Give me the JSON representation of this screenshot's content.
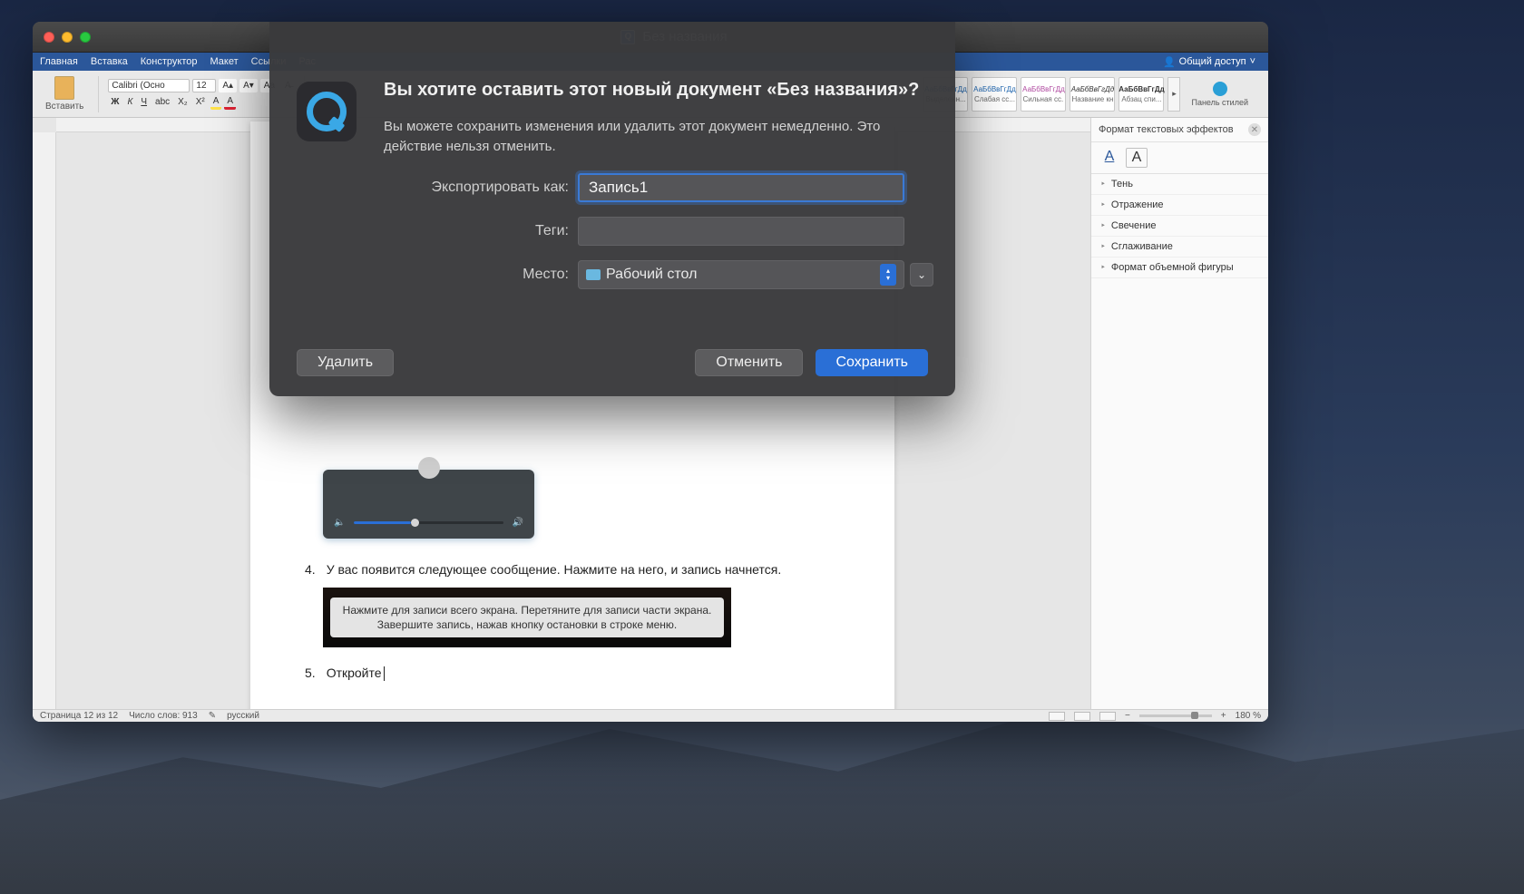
{
  "window": {
    "title": "Без названия"
  },
  "word": {
    "tabs": [
      "Главная",
      "Вставка",
      "Конструктор",
      "Макет",
      "Ссылки",
      "Рас"
    ],
    "share": "Общий доступ",
    "paste_label": "Вставить",
    "font_name": "Calibri (Осно",
    "font_size": "12",
    "styles": [
      {
        "preview": "АаБбВвГгДд",
        "label": "Выделенн..."
      },
      {
        "preview": "АаБбВвГгДд",
        "label": "Слабая сс..."
      },
      {
        "preview": "АаБбВвГгДд",
        "label": "Сильная сс..."
      },
      {
        "preview": "АаБбВвГгДд",
        "label": "Название кн..."
      },
      {
        "preview": "АаБбВвГгДд",
        "label": "Абзац спи..."
      }
    ],
    "panel_label": "Панель стилей"
  },
  "right_panel": {
    "title": "Формат текстовых эффектов",
    "items": [
      "Тень",
      "Отражение",
      "Свечение",
      "Сглаживание",
      "Формат объемной фигуры"
    ]
  },
  "document": {
    "item4_num": "4.",
    "item4": "У вас появится следующее сообщение. Нажмите на него, и запись начнется.",
    "tooltip_line1": "Нажмите для записи всего экрана. Перетяните для записи части экрана.",
    "tooltip_line2": "Завершите запись, нажав кнопку остановки в строке меню.",
    "item5_num": "5.",
    "item5": "Откройте"
  },
  "status": {
    "page": "Страница 12 из 12",
    "words": "Число слов: 913",
    "lang": "русский",
    "zoom": "180 %"
  },
  "dialog": {
    "heading": "Вы хотите оставить этот новый документ «Без названия»?",
    "sub": "Вы можете сохранить изменения или удалить этот документ немедленно. Это действие нельзя отменить.",
    "export_label": "Экспортировать как:",
    "export_value": "Запись1",
    "tags_label": "Теги:",
    "tags_value": "",
    "location_label": "Место:",
    "location_value": "Рабочий стол",
    "delete": "Удалить",
    "cancel": "Отменить",
    "save": "Сохранить"
  }
}
